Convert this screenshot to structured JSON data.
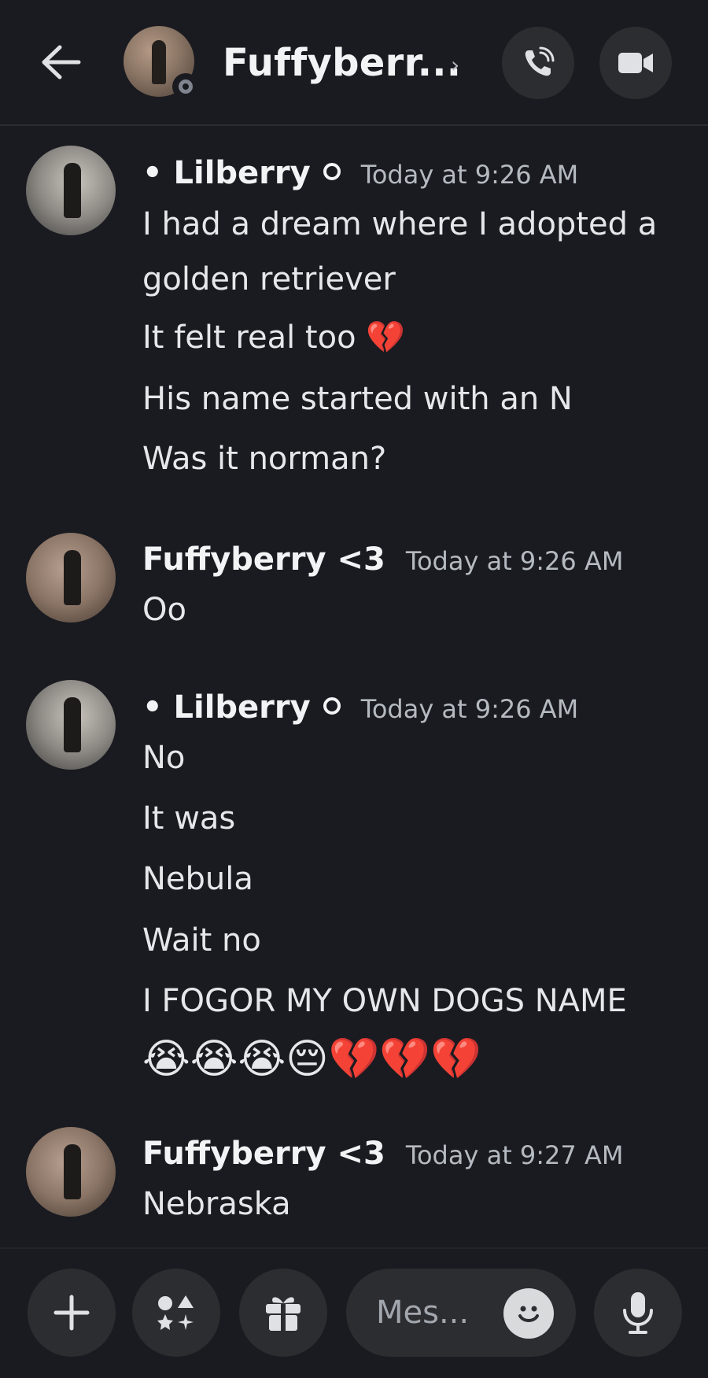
{
  "header": {
    "title": "Fuffyberr...",
    "chevron": "›",
    "icons": {
      "back": "arrow-left-icon",
      "call": "phone-call-icon",
      "video": "video-camera-icon"
    }
  },
  "messages": [
    {
      "author": "• Lilberry",
      "timestamp": "Today at 9:26 AM",
      "lines": [
        "I had a dream where I adopted a",
        "golden retriever",
        "It felt real too 💔",
        "His name started with an N",
        "Was it norman?"
      ]
    },
    {
      "author": "Fuffyberry <3",
      "timestamp": "Today at 9:26 AM",
      "lines": [
        "Oo"
      ]
    },
    {
      "author": "• Lilberry",
      "timestamp": "Today at 9:26 AM",
      "lines": [
        "No",
        "It was",
        "Nebula",
        "Wait no",
        "I FOGOR MY OWN DOGS NAME",
        "😭😭😭😔💔💔💔"
      ]
    },
    {
      "author": "Fuffyberry <3",
      "timestamp": "Today at 9:27 AM",
      "lines": [
        "Nebraska"
      ]
    }
  ],
  "composer": {
    "placeholder": "Mes...",
    "icons": {
      "plus": "plus-icon",
      "apps": "apps-icon",
      "gift": "gift-icon",
      "emoji": "emoji-smile-icon",
      "mic": "microphone-icon"
    }
  },
  "colors": {
    "background": "#1a1b20",
    "button_bg": "#2b2d31",
    "text": "#f2f3f5",
    "muted": "#b5bac1"
  }
}
